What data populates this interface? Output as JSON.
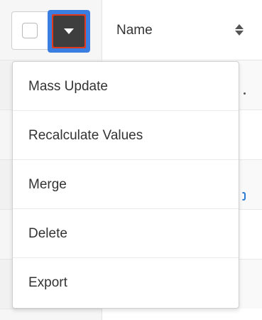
{
  "table": {
    "header": {
      "name_label": "Name",
      "sort_icon": "sort-icon"
    }
  },
  "actions": {
    "checkbox_checked": false,
    "dropdown_icon": "caret-down-icon"
  },
  "menu": {
    "items": [
      {
        "label": "Mass Update"
      },
      {
        "label": "Recalculate Values"
      },
      {
        "label": "Merge"
      },
      {
        "label": "Delete"
      },
      {
        "label": "Export"
      }
    ]
  },
  "colors": {
    "accent_blue": "#3a7ee2",
    "highlight_red": "#e03a1e",
    "button_dark": "#3e3e3e",
    "link_blue": "#2a7bd1"
  }
}
